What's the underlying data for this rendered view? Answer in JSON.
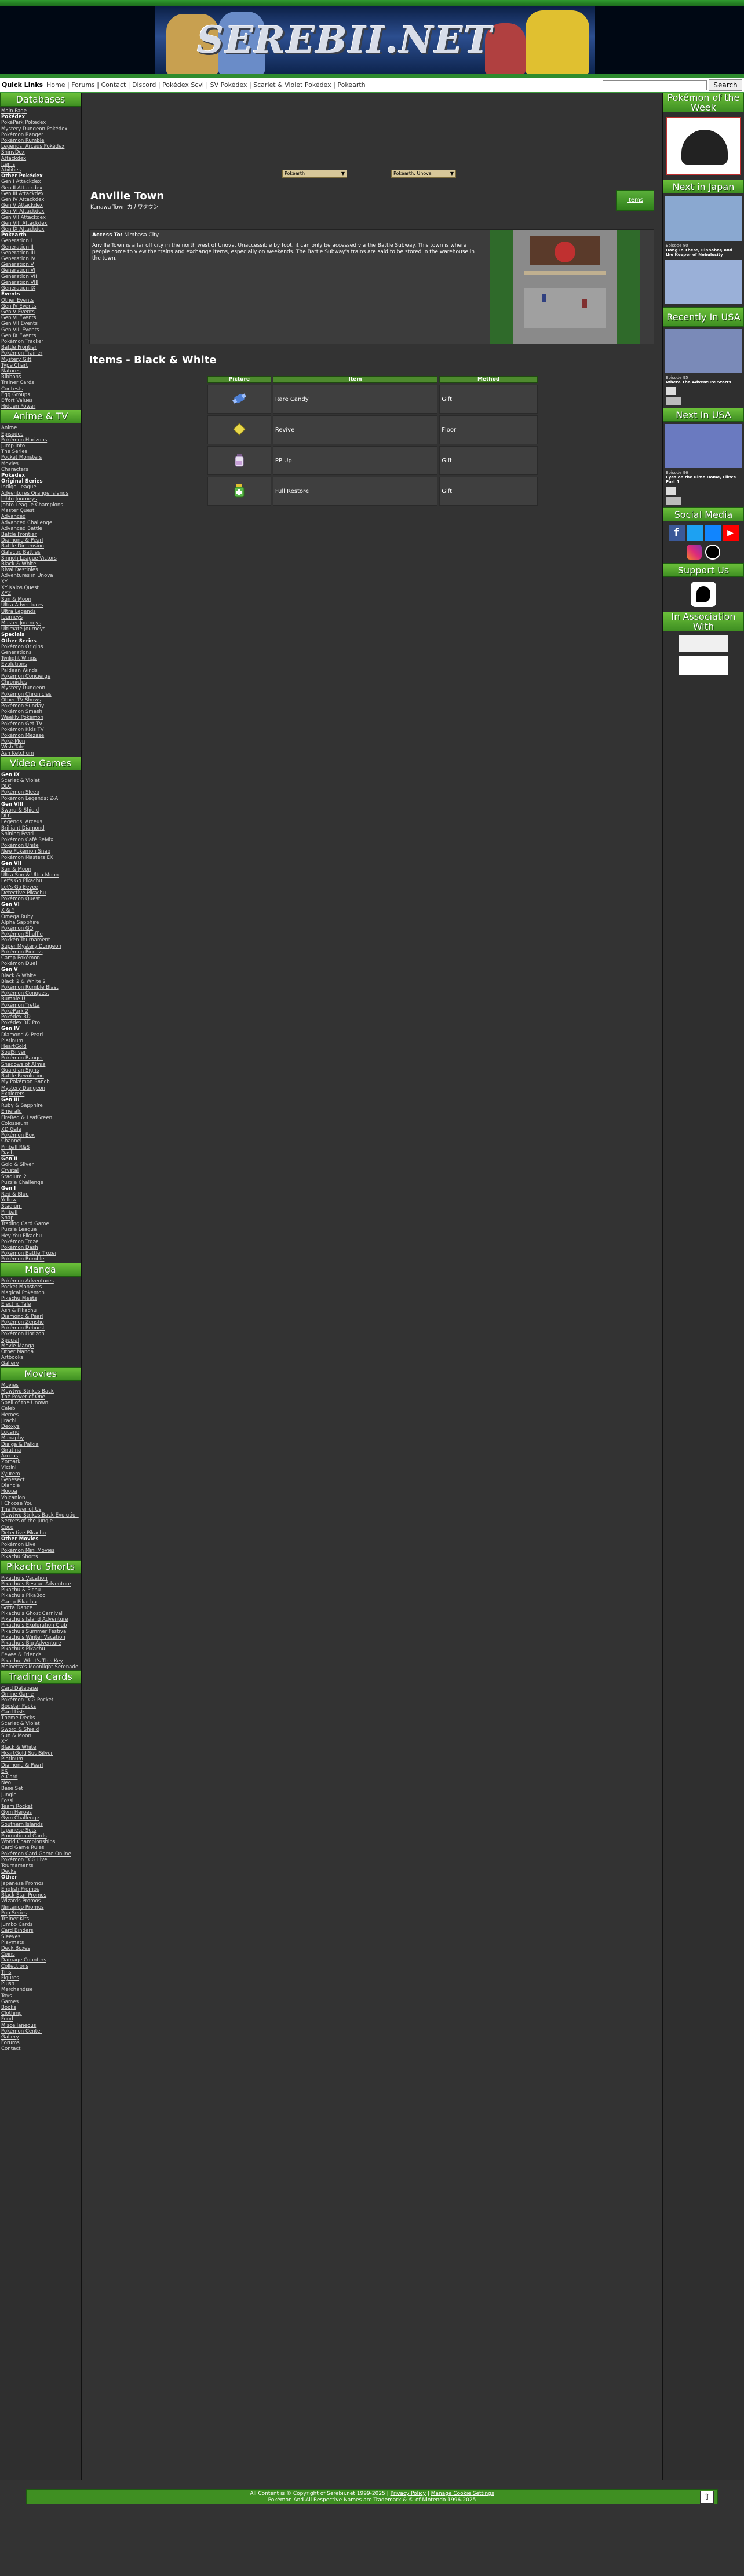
{
  "site": {
    "logo_text": "SEREBII.NET"
  },
  "quick_links": {
    "title": "Quick Links",
    "links": [
      "Home",
      "Forums",
      "Contact",
      "Discord",
      "Pokédex Scvi",
      "SV Pokédex",
      "Scarlet & Violet Pokédex",
      "Pokearth"
    ],
    "search_button": "Search"
  },
  "nav": {
    "sections": [
      {
        "title": "Databases",
        "items": [
          "Main Page",
          "Pokédex",
          "PokéPark Pokédex",
          "Mystery Dungeon Pokédex",
          "Pokémon Ranger",
          "Pokémon Rumble",
          "Legends: Arceus Pokédex",
          "ShinyDex",
          "Attackdex",
          "Items",
          "Abilities",
          "Other Pokédex",
          "Gen I Attackdex",
          "Gen II Attackdex",
          "Gen III Attackdex",
          "Gen IV Attackdex",
          "Gen V Attackdex",
          "Gen VI Attackdex",
          "Gen VII Attackdex",
          "Gen VIII Attackdex",
          "Gen IX Attackdex",
          "Pokearth",
          "Generation I",
          "Generation II",
          "Generation III",
          "Generation IV",
          "Generation V",
          "Generation VI",
          "Generation VII",
          "Generation VIII",
          "Generation IX",
          "Events",
          "Other Events",
          "Gen IV Events",
          "Gen V Events",
          "Gen VI Events",
          "Gen VII Events",
          "Gen VIII Events",
          "Gen IX Events",
          "Pokémon Tracker",
          "Battle Frontier",
          "Pokémon Trainer",
          "Mystery Gift",
          "Type Chart",
          "Natures",
          "Ribbons",
          "Trainer Cards",
          "Contests",
          "Egg Groups",
          "Effort Values",
          "Hidden Power"
        ]
      },
      {
        "title": "Anime & TV",
        "items": [
          "Anime",
          "Episodes",
          "Pokémon Horizons",
          "Jump Into",
          "The Series",
          "Pocket Monsters",
          "Movies",
          "Characters",
          "Pokédex",
          "Original Series",
          "Indigo League",
          "Adventures Orange Islands",
          "Johto Journeys",
          "Johto League Champions",
          "Master Quest",
          "Advanced",
          "Advanced Challenge",
          "Advanced Battle",
          "Battle Frontier",
          "Diamond & Pearl",
          "Battle Dimension",
          "Galactic Battles",
          "Sinnoh League Victors",
          "Black & White",
          "Rival Destinies",
          "Adventures in Unova",
          "XY",
          "XY Kalos Quest",
          "XYZ",
          "Sun & Moon",
          "Ultra Adventures",
          "Ultra Legends",
          "Journeys",
          "Master Journeys",
          "Ultimate Journeys",
          "Specials",
          "Other Series",
          "Pokémon Origins",
          "Generations",
          "Twilight Wings",
          "Evolutions",
          "Paldean Winds",
          "Pokémon Concierge",
          "Chronicles",
          "Mystery Dungeon",
          "Pokémon Chronicles",
          "Other TV Shows",
          "Pokémon Sunday",
          "Pokémon Smash",
          "Weekly Pokémon",
          "Pokémon Get TV",
          "Pokémon Kids TV",
          "Pokémon Mezase",
          "Poké-Mon",
          "Wish Tale",
          "Ash Ketchum"
        ]
      },
      {
        "title": "Video Games",
        "items": [
          "Gen IX",
          "Scarlet & Violet",
          "DLC",
          "Pokémon Sleep",
          "Pokémon Legends: Z-A",
          "Gen VIII",
          "Sword & Shield",
          "DLC",
          "Legends: Arceus",
          "Brilliant Diamond",
          "Shining Pearl",
          "Pokémon Café ReMix",
          "Pokémon Unite",
          "New Pokémon Snap",
          "Pokémon Masters EX",
          "Gen VII",
          "Sun & Moon",
          "Ultra Sun & Ultra Moon",
          "Let's Go Pikachu",
          "Let's Go Eevee",
          "Detective Pikachu",
          "Pokémon Quest",
          "Gen VI",
          "X & Y",
          "Omega Ruby",
          "Alpha Sapphire",
          "Pokémon GO",
          "Pokémon Shuffle",
          "Pokkén Tournament",
          "Super Mystery Dungeon",
          "Pokémon Picross",
          "Camp Pokémon",
          "Pokémon Duel",
          "Gen V",
          "Black & White",
          "Black 2 & White 2",
          "Pokémon Rumble Blast",
          "Pokémon Conquest",
          "Rumble U",
          "Pokémon Tretta",
          "PokéPark 2",
          "Pokédex 3D",
          "Pokédex 3D Pro",
          "Gen IV",
          "Diamond & Pearl",
          "Platinum",
          "HeartGold",
          "SoulSilver",
          "Pokémon Ranger",
          "Shadows of Almia",
          "Guardian Signs",
          "Battle Revolution",
          "My Pokémon Ranch",
          "Mystery Dungeon",
          "Explorers",
          "Gen III",
          "Ruby & Sapphire",
          "Emerald",
          "FireRed & LeafGreen",
          "Colosseum",
          "XD Gale",
          "Pokémon Box",
          "Channel",
          "Pinball R&S",
          "Dash",
          "Gen II",
          "Gold & Silver",
          "Crystal",
          "Stadium 2",
          "Puzzle Challenge",
          "Gen I",
          "Red & Blue",
          "Yellow",
          "Stadium",
          "Pinball",
          "Snap",
          "Trading Card Game",
          "Puzzle League",
          "Hey You Pikachu",
          "Pokémon Trozei",
          "Pokémon Dash",
          "Pokémon Battle Trozei",
          "Pokémon Rumble"
        ]
      },
      {
        "title": "Manga",
        "items": [
          "Pokémon Adventures",
          "Pocket Monsters",
          "Magical Pokémon",
          "Pikachu Meets",
          "Electric Tale",
          "Ash & Pikachu",
          "Diamond & Pearl",
          "Pokémon Zensho",
          "Pokémon Reburst",
          "Pokémon Horizon",
          "Special",
          "Movie Manga",
          "Other Manga",
          "Artbooks",
          "Gallery"
        ]
      },
      {
        "title": "Movies",
        "items": [
          "Movies",
          "Mewtwo Strikes Back",
          "The Power of One",
          "Spell of the Unown",
          "Celebi",
          "Heroes",
          "Jirachi",
          "Deoxys",
          "Lucario",
          "Manaphy",
          "Dialga & Palkia",
          "Giratina",
          "Arceus",
          "Zoroark",
          "Victini",
          "Kyurem",
          "Genesect",
          "Diancie",
          "Hoopa",
          "Volcanion",
          "I Choose You",
          "The Power of Us",
          "Mewtwo Strikes Back Evolution",
          "Secrets of the Jungle",
          "Coco",
          "Detective Pikachu",
          "Other Movies",
          "Pokémon Live",
          "Pokémon Mini Movies",
          "Pikachu Shorts"
        ]
      },
      {
        "title": "Pikachu Shorts",
        "items": [
          "Pikachu's Vacation",
          "Pikachu's Rescue Adventure",
          "Pikachu & Pichu",
          "Pikachu's PikaBoo",
          "Camp Pikachu",
          "Gotta Dance",
          "Pikachu's Ghost Carnival",
          "Pikachu's Island Adventure",
          "Pikachu's Exploration Club",
          "Pikachu's Summer Festival",
          "Pikachu's Winter Vacation",
          "Pikachu's Big Adventure",
          "Pikachu's Pikachu",
          "Eevee & Friends",
          "Pikachu, What's This Key",
          "Meloetta's Moonlight Serenade"
        ]
      },
      {
        "title": "Trading Cards",
        "items": [
          "Card Database",
          "Online Game",
          "Pokémon TCG Pocket",
          "Booster Packs",
          "Card Lists",
          "Theme Decks",
          "Scarlet & Violet",
          "Sword & Shield",
          "Sun & Moon",
          "XY",
          "Black & White",
          "HeartGold SoulSilver",
          "Platinum",
          "Diamond & Pearl",
          "EX",
          "e-Card",
          "Neo",
          "Base Set",
          "Jungle",
          "Fossil",
          "Team Rocket",
          "Gym Heroes",
          "Gym Challenge",
          "Southern Islands",
          "Japanese Sets",
          "Promotional Cards",
          "World Championships",
          "Card Game Rules",
          "Pokémon Card Game Online",
          "Pokémon TCG Live",
          "Tournaments",
          "Decks",
          "Other",
          "Japanese Promos",
          "English Promos",
          "Black Star Promos",
          "Wizards Promos",
          "Nintendo Promos",
          "Pop Series",
          "Trainer Kits",
          "Jumbo Cards",
          "Card Binders",
          "Sleeves",
          "Playmats",
          "Deck Boxes",
          "Coins",
          "Damage Counters",
          "Collections",
          "Tins",
          "Figures",
          "Plush",
          "Merchandise",
          "Toys",
          "Games",
          "Books",
          "Clothing",
          "Food",
          "Miscellaneous",
          "Pokémon Center",
          "Gallery",
          "Forums",
          "Contact"
        ]
      }
    ]
  },
  "selectors": {
    "left": "Pokéarth",
    "right": "Pokéarth: Unova"
  },
  "location": {
    "title": "Anville Town",
    "subtitle": "Kanawa Town カナワタウン",
    "items_button": "Items",
    "access_label": "Access To:",
    "access_link": "Nimbasa City",
    "description": "Anville Town is a far off city in the north west of Unova. Unaccessible by foot, it can only be accessed via the Battle Subway. This town is where people come to view the trains and exchange items, especially on weekends. The Battle Subway's trains are said to be stored in the warehouse in the town."
  },
  "items_section": {
    "title": "Items - Black & White",
    "headers": [
      "Picture",
      "Item",
      "Method"
    ],
    "rows": [
      {
        "item": "Rare Candy",
        "method": "Gift",
        "icon": "rare-candy-icon",
        "color": "#4d7fd4"
      },
      {
        "item": "Revive",
        "method": "Floor",
        "icon": "revive-icon",
        "color": "#e8d84a"
      },
      {
        "item": "PP Up",
        "method": "Gift",
        "icon": "pp-up-icon",
        "color": "#c8a0d8"
      },
      {
        "item": "Full Restore",
        "method": "Gift",
        "icon": "full-restore-icon",
        "color": "#5ab84a"
      }
    ]
  },
  "right": {
    "potw": {
      "title": "Pokémon of the Week"
    },
    "next_japan": {
      "title": "Next in Japan",
      "caption1": "Episode 80",
      "caption2": "Hang In There, Cinnabar, and the Keeper of Nebulosity"
    },
    "recent_usa": {
      "title": "Recently In USA",
      "caption1": "Episode 95",
      "caption2": "Where The Adventure Starts"
    },
    "next_usa": {
      "title": "Next In USA",
      "caption1": "Episode 96",
      "caption2": "Eyes on the Rime Dome, Liko's Part 1"
    },
    "social": {
      "title": "Social Media"
    },
    "support": {
      "title": "Support Us"
    },
    "assoc": {
      "title": "In Association With"
    }
  },
  "footer": {
    "line1_prefix": "All Content is © Copyright of Serebii.net 1999-2025 |",
    "privacy": "Privacy Policy",
    "sep": "|",
    "cookies": "Manage Cookie Settings",
    "line2": "Pokémon And All Respective Names are Trademark & © of Nintendo 1996-2025"
  },
  "colors": {
    "accent": "#3f8f22",
    "background": "#333333"
  }
}
